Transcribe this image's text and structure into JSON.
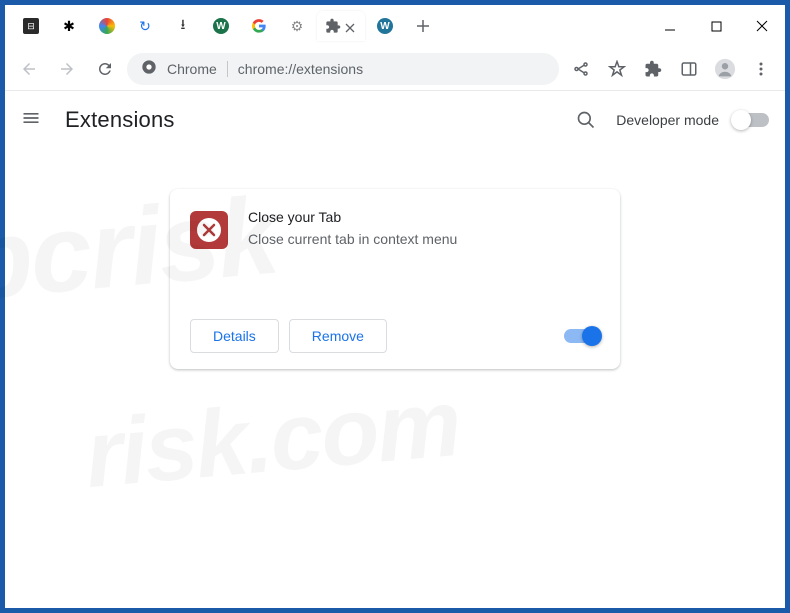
{
  "window": {
    "tabs": [
      "projector",
      "film",
      "rainbow",
      "recycle",
      "download",
      "w-badge",
      "google",
      "gear",
      "puzzle",
      "wordpress"
    ]
  },
  "omnibox": {
    "chip": "Chrome",
    "url": "chrome://extensions"
  },
  "header": {
    "title": "Extensions",
    "dev_mode_label": "Developer mode"
  },
  "extension": {
    "name": "Close your Tab",
    "description": "Close current tab in context menu",
    "details_label": "Details",
    "remove_label": "Remove"
  },
  "watermark": {
    "line1": "pcrisk",
    "line2": "risk.com"
  }
}
